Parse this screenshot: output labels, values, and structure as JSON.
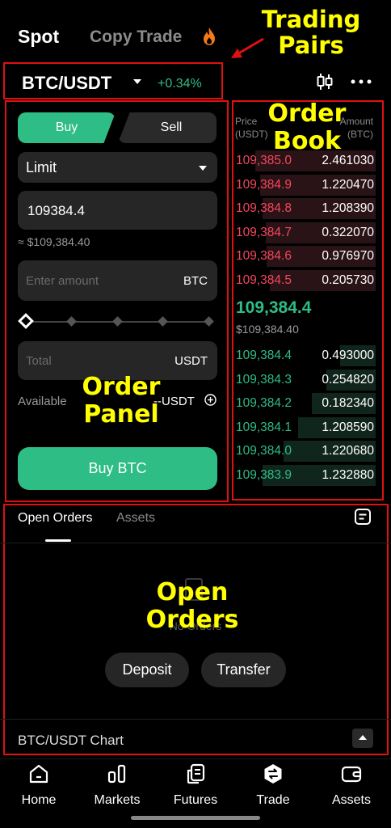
{
  "header": {
    "tabs": [
      "Spot",
      "Copy Trade"
    ]
  },
  "annotations": {
    "trading_pairs": [
      "Trading",
      "Pairs"
    ],
    "order_book": [
      "Order",
      "Book"
    ],
    "order_panel": [
      "Order",
      "Panel"
    ],
    "open_orders": [
      "Open",
      "Orders"
    ]
  },
  "pair": {
    "symbol": "BTC/USDT",
    "change": "+0.34%"
  },
  "order_panel": {
    "buy_label": "Buy",
    "sell_label": "Sell",
    "order_type": "Limit",
    "price_value": "109384.4",
    "price_approx": "≈ $109,384.40",
    "amount_placeholder": "Enter amount",
    "amount_unit": "BTC",
    "total_placeholder": "Total",
    "total_unit": "USDT",
    "available_label": "Available",
    "available_value": "--USDT",
    "submit_label": "Buy BTC"
  },
  "order_book": {
    "price_header": [
      "Price",
      "(USDT)"
    ],
    "amount_header": [
      "Amount",
      "(BTC)"
    ],
    "asks": [
      {
        "price": "109,385.0",
        "amount": "2.461030",
        "depth": 0.85
      },
      {
        "price": "109,384.9",
        "amount": "1.220470",
        "depth": 0.82
      },
      {
        "price": "109,384.8",
        "amount": "1.208390",
        "depth": 0.8
      },
      {
        "price": "109,384.7",
        "amount": "0.322070",
        "depth": 0.78
      },
      {
        "price": "109,384.6",
        "amount": "0.976970",
        "depth": 0.77
      },
      {
        "price": "109,384.5",
        "amount": "0.205730",
        "depth": 0.75
      }
    ],
    "mid_price": "109,384.4",
    "mid_price_usd": "$109,384.40",
    "bids": [
      {
        "price": "109,384.4",
        "amount": "0.493000",
        "depth": 0.25
      },
      {
        "price": "109,384.3",
        "amount": "0.254820",
        "depth": 0.35
      },
      {
        "price": "109,384.2",
        "amount": "0.182340",
        "depth": 0.45
      },
      {
        "price": "109,384.1",
        "amount": "1.208590",
        "depth": 0.55
      },
      {
        "price": "109,384.0",
        "amount": "1.220680",
        "depth": 0.65
      },
      {
        "price": "109,383.9",
        "amount": "1.232880",
        "depth": 0.8
      }
    ],
    "ask_color": "#f6465d",
    "bid_color": "#2ebd85"
  },
  "orders": {
    "tabs": [
      "Open Orders",
      "Assets"
    ],
    "empty_text": "No Orders",
    "deposit_label": "Deposit",
    "transfer_label": "Transfer",
    "chart_label": "BTC/USDT Chart"
  },
  "bottom_nav": [
    {
      "label": "Home",
      "icon": "home-icon"
    },
    {
      "label": "Markets",
      "icon": "markets-icon"
    },
    {
      "label": "Futures",
      "icon": "futures-icon"
    },
    {
      "label": "Trade",
      "icon": "trade-icon"
    },
    {
      "label": "Assets",
      "icon": "wallet-icon"
    }
  ]
}
